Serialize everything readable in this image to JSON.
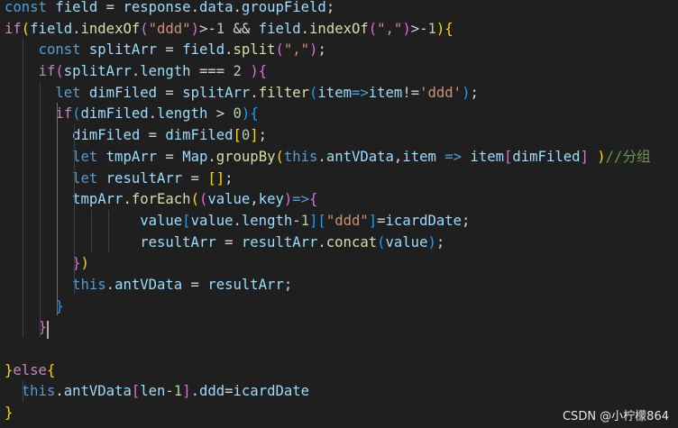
{
  "code_lines": [
    [
      {
        "t": "const",
        "c": "kw"
      },
      {
        "t": " "
      },
      {
        "t": "field",
        "c": "var"
      },
      {
        "t": " = "
      },
      {
        "t": "response",
        "c": "var"
      },
      {
        "t": "."
      },
      {
        "t": "data",
        "c": "var"
      },
      {
        "t": "."
      },
      {
        "t": "groupField",
        "c": "var"
      },
      {
        "t": ";"
      }
    ],
    [
      {
        "t": "if",
        "c": "ctl"
      },
      {
        "t": "(",
        "c": "b1"
      },
      {
        "t": "field",
        "c": "var"
      },
      {
        "t": "."
      },
      {
        "t": "indexOf",
        "c": "fn"
      },
      {
        "t": "(",
        "c": "b2"
      },
      {
        "t": "\"ddd\"",
        "c": "str"
      },
      {
        "t": ")",
        "c": "b2"
      },
      {
        "t": ">-"
      },
      {
        "t": "1",
        "c": "num"
      },
      {
        "t": " && "
      },
      {
        "t": "field",
        "c": "var"
      },
      {
        "t": "."
      },
      {
        "t": "indexOf",
        "c": "fn"
      },
      {
        "t": "(",
        "c": "b2"
      },
      {
        "t": "\",\"",
        "c": "str"
      },
      {
        "t": ")",
        "c": "b2"
      },
      {
        "t": ">-"
      },
      {
        "t": "1",
        "c": "num"
      },
      {
        "t": ")",
        "c": "b1"
      },
      {
        "t": "{",
        "c": "b1"
      }
    ],
    [
      {
        "t": "    "
      },
      {
        "t": "const",
        "c": "kw"
      },
      {
        "t": " "
      },
      {
        "t": "splitArr",
        "c": "var"
      },
      {
        "t": " = "
      },
      {
        "t": "field",
        "c": "var"
      },
      {
        "t": "."
      },
      {
        "t": "split",
        "c": "fn"
      },
      {
        "t": "(",
        "c": "b2"
      },
      {
        "t": "\",\"",
        "c": "str"
      },
      {
        "t": ")",
        "c": "b2"
      },
      {
        "t": ";"
      }
    ],
    [
      {
        "t": "    "
      },
      {
        "t": "if",
        "c": "ctl"
      },
      {
        "t": "(",
        "c": "b2"
      },
      {
        "t": "splitArr",
        "c": "var"
      },
      {
        "t": "."
      },
      {
        "t": "length",
        "c": "var"
      },
      {
        "t": " === "
      },
      {
        "t": "2",
        "c": "num"
      },
      {
        "t": " "
      },
      {
        "t": ")",
        "c": "b2"
      },
      {
        "t": "{",
        "c": "b2"
      }
    ],
    [
      {
        "t": "      "
      },
      {
        "t": "let",
        "c": "kw"
      },
      {
        "t": " "
      },
      {
        "t": "dimFiled",
        "c": "var"
      },
      {
        "t": " = "
      },
      {
        "t": "splitArr",
        "c": "var"
      },
      {
        "t": "."
      },
      {
        "t": "filter",
        "c": "fn"
      },
      {
        "t": "(",
        "c": "b3"
      },
      {
        "t": "item",
        "c": "var"
      },
      {
        "t": "=>",
        "c": "kw"
      },
      {
        "t": "item",
        "c": "var"
      },
      {
        "t": "!="
      },
      {
        "t": "'ddd'",
        "c": "str"
      },
      {
        "t": ")",
        "c": "b3"
      },
      {
        "t": ";"
      }
    ],
    [
      {
        "t": "      "
      },
      {
        "t": "if",
        "c": "ctl"
      },
      {
        "t": "(",
        "c": "b3"
      },
      {
        "t": "dimFiled",
        "c": "var"
      },
      {
        "t": "."
      },
      {
        "t": "length",
        "c": "var"
      },
      {
        "t": " > "
      },
      {
        "t": "0",
        "c": "num"
      },
      {
        "t": ")",
        "c": "b3"
      },
      {
        "t": "{",
        "c": "b3"
      }
    ],
    [
      {
        "t": "        "
      },
      {
        "t": "dimFiled",
        "c": "var"
      },
      {
        "t": " = "
      },
      {
        "t": "dimFiled",
        "c": "var"
      },
      {
        "t": "[",
        "c": "b1"
      },
      {
        "t": "0",
        "c": "num"
      },
      {
        "t": "]",
        "c": "b1"
      },
      {
        "t": ";"
      }
    ],
    [
      {
        "t": "        "
      },
      {
        "t": "let",
        "c": "kw"
      },
      {
        "t": " "
      },
      {
        "t": "tmpArr",
        "c": "var"
      },
      {
        "t": " = "
      },
      {
        "t": "Map",
        "c": "var"
      },
      {
        "t": "."
      },
      {
        "t": "groupBy",
        "c": "fn"
      },
      {
        "t": "(",
        "c": "b1"
      },
      {
        "t": "this",
        "c": "kw"
      },
      {
        "t": "."
      },
      {
        "t": "antVData",
        "c": "var"
      },
      {
        "t": ","
      },
      {
        "t": "item",
        "c": "var"
      },
      {
        "t": " "
      },
      {
        "t": "=>",
        "c": "kw"
      },
      {
        "t": " "
      },
      {
        "t": "item",
        "c": "var"
      },
      {
        "t": "[",
        "c": "b2"
      },
      {
        "t": "dimFiled",
        "c": "var"
      },
      {
        "t": "]",
        "c": "b2"
      },
      {
        "t": " "
      },
      {
        "t": ")",
        "c": "b1"
      },
      {
        "t": "//分组",
        "c": "cmt"
      }
    ],
    [
      {
        "t": "        "
      },
      {
        "t": "let",
        "c": "kw"
      },
      {
        "t": " "
      },
      {
        "t": "resultArr",
        "c": "var"
      },
      {
        "t": " = "
      },
      {
        "t": "[",
        "c": "b1"
      },
      {
        "t": "]",
        "c": "b1"
      },
      {
        "t": ";"
      }
    ],
    [
      {
        "t": "        "
      },
      {
        "t": "tmpArr",
        "c": "var"
      },
      {
        "t": "."
      },
      {
        "t": "forEach",
        "c": "fn"
      },
      {
        "t": "(",
        "c": "b1"
      },
      {
        "t": "(",
        "c": "b2"
      },
      {
        "t": "value",
        "c": "var"
      },
      {
        "t": ","
      },
      {
        "t": "key",
        "c": "var"
      },
      {
        "t": ")",
        "c": "b2"
      },
      {
        "t": "=>",
        "c": "kw"
      },
      {
        "t": "{",
        "c": "b2"
      }
    ],
    [
      {
        "t": "                "
      },
      {
        "t": "value",
        "c": "var"
      },
      {
        "t": "[",
        "c": "b3"
      },
      {
        "t": "value",
        "c": "var"
      },
      {
        "t": "."
      },
      {
        "t": "length",
        "c": "var"
      },
      {
        "t": "-"
      },
      {
        "t": "1",
        "c": "num"
      },
      {
        "t": "]",
        "c": "b3"
      },
      {
        "t": "[",
        "c": "b3"
      },
      {
        "t": "\"ddd\"",
        "c": "str"
      },
      {
        "t": "]",
        "c": "b3"
      },
      {
        "t": "="
      },
      {
        "t": "icardDate",
        "c": "var"
      },
      {
        "t": ";"
      }
    ],
    [
      {
        "t": "                "
      },
      {
        "t": "resultArr",
        "c": "var"
      },
      {
        "t": " = "
      },
      {
        "t": "resultArr",
        "c": "var"
      },
      {
        "t": "."
      },
      {
        "t": "concat",
        "c": "fn"
      },
      {
        "t": "(",
        "c": "b3"
      },
      {
        "t": "value",
        "c": "var"
      },
      {
        "t": ")",
        "c": "b3"
      },
      {
        "t": ";"
      }
    ],
    [
      {
        "t": "        "
      },
      {
        "t": "}",
        "c": "b2"
      },
      {
        "t": ")",
        "c": "b1"
      }
    ],
    [
      {
        "t": "        "
      },
      {
        "t": "this",
        "c": "kw"
      },
      {
        "t": "."
      },
      {
        "t": "antVData",
        "c": "var"
      },
      {
        "t": " = "
      },
      {
        "t": "resultArr",
        "c": "var"
      },
      {
        "t": ";"
      }
    ],
    [
      {
        "t": "      "
      },
      {
        "t": "}",
        "c": "b3"
      }
    ],
    [
      {
        "t": "    "
      },
      {
        "t": "}",
        "c": "b2"
      }
    ],
    [],
    [
      {
        "t": "}",
        "c": "b1"
      },
      {
        "t": "else",
        "c": "ctl"
      },
      {
        "t": "{",
        "c": "b1"
      }
    ],
    [
      {
        "t": "  "
      },
      {
        "t": "this",
        "c": "kw"
      },
      {
        "t": "."
      },
      {
        "t": "antVData",
        "c": "var"
      },
      {
        "t": "[",
        "c": "b2"
      },
      {
        "t": "len",
        "c": "var"
      },
      {
        "t": "-"
      },
      {
        "t": "1",
        "c": "num"
      },
      {
        "t": "]",
        "c": "b2"
      },
      {
        "t": "."
      },
      {
        "t": "ddd",
        "c": "var"
      },
      {
        "t": "="
      },
      {
        "t": "icardDate",
        "c": "var"
      }
    ],
    [
      {
        "t": "}",
        "c": "b1"
      }
    ]
  ],
  "watermark": "CSDN @小柠檬864"
}
